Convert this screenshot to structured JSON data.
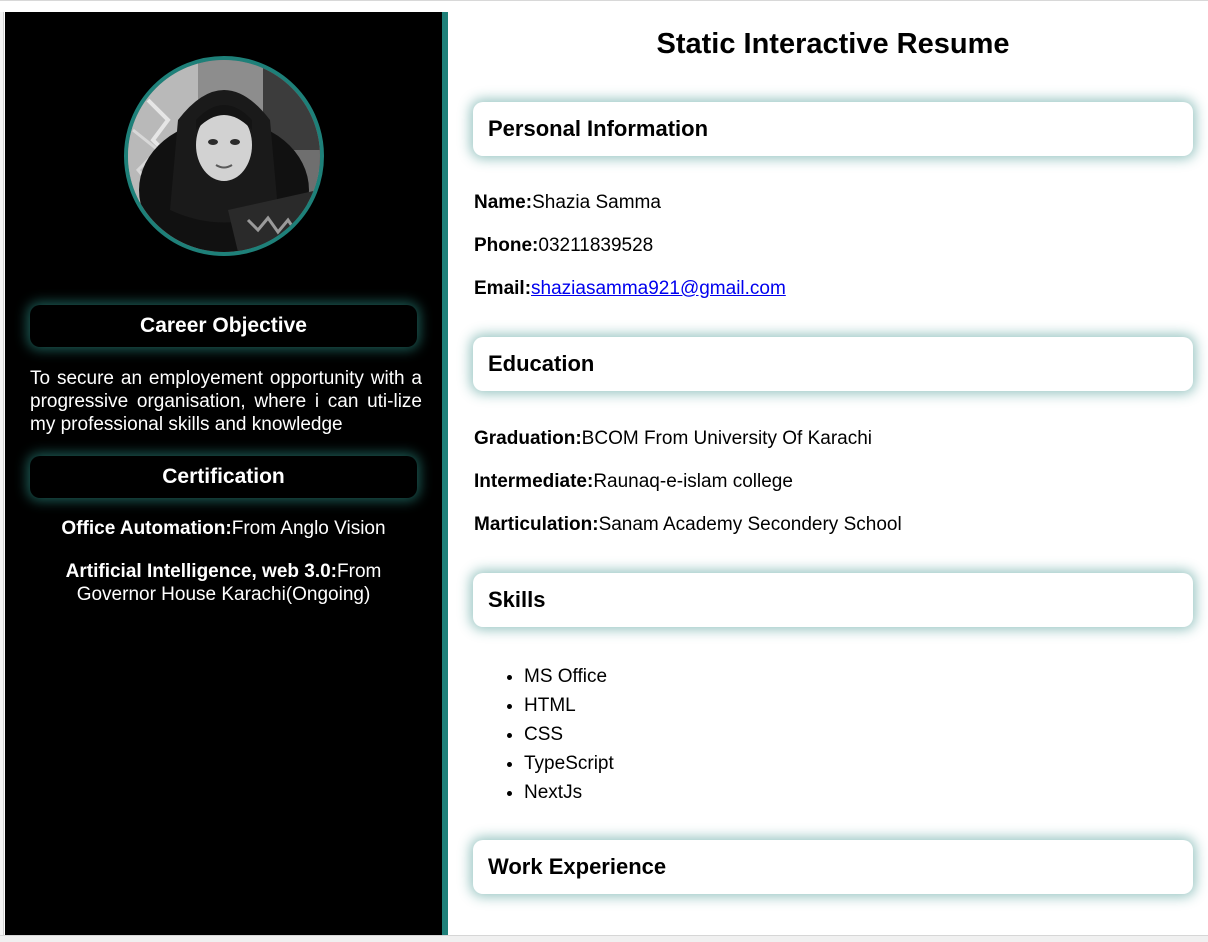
{
  "sidebar": {
    "career_objective_heading": "Career Objective",
    "career_objective_text": "To secure an employement opportunity with a progressive organisation, where i can uti-lize my professional skills and knowledge",
    "certification_heading": "Certification",
    "certifications": [
      {
        "label": "Office Automation:",
        "value": "From Anglo Vision"
      },
      {
        "label": "Artificial Intelligence, web 3.0:",
        "value": "From Governor House Karachi(Ongoing)"
      }
    ]
  },
  "main": {
    "title": "Static Interactive Resume",
    "personal_information": {
      "heading": "Personal Information",
      "name_label": "Name:",
      "name_value": "Shazia Samma",
      "phone_label": "Phone:",
      "phone_value": "03211839528",
      "email_label": "Email:",
      "email_value": "shaziasamma921@gmail.com"
    },
    "education": {
      "heading": "Education",
      "items": [
        {
          "label": "Graduation:",
          "value": "BCOM From University Of Karachi"
        },
        {
          "label": "Intermediate:",
          "value": "Raunaq-e-islam college"
        },
        {
          "label": "Marticulation:",
          "value": "Sanam Academy Secondery School"
        }
      ]
    },
    "skills": {
      "heading": "Skills",
      "items": [
        "MS Office",
        "HTML",
        "CSS",
        "TypeScript",
        "NextJs"
      ]
    },
    "work_experience": {
      "heading": "Work Experience"
    }
  },
  "colors": {
    "sidebar_bg": "#000000",
    "accent": "#1e8079",
    "link": "#0000ee"
  }
}
